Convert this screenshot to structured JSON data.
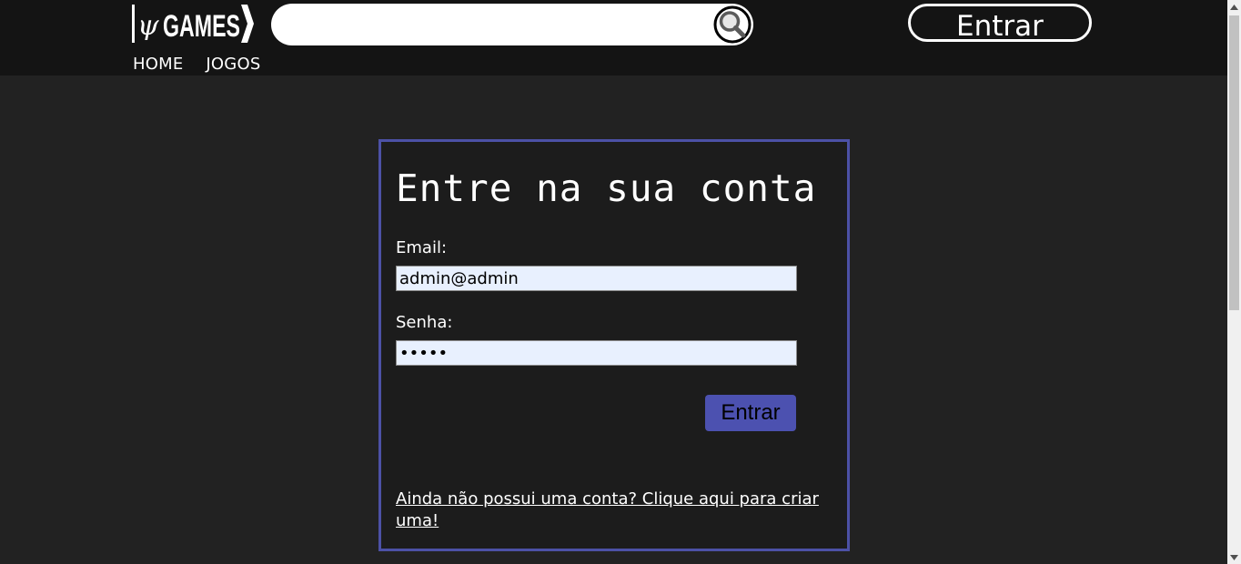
{
  "header": {
    "logo_text": "ψGAMES",
    "search": {
      "placeholder": "",
      "value": "",
      "icon": "search-icon"
    },
    "login_label": "Entrar",
    "nav": [
      "HOME",
      "JOGOS"
    ]
  },
  "login_card": {
    "title": "Entre na sua conta",
    "email_label": "Email:",
    "email_value": "admin@admin",
    "password_label": "Senha:",
    "password_value": "•••••",
    "submit_label": "Entrar",
    "signup_text": "Ainda não possui uma conta? Clique aqui para criar uma!"
  },
  "colors": {
    "page_bg": "#222222",
    "header_bg": "#141414",
    "accent": "#4c51a6",
    "input_bg": "#e8f0fe"
  }
}
